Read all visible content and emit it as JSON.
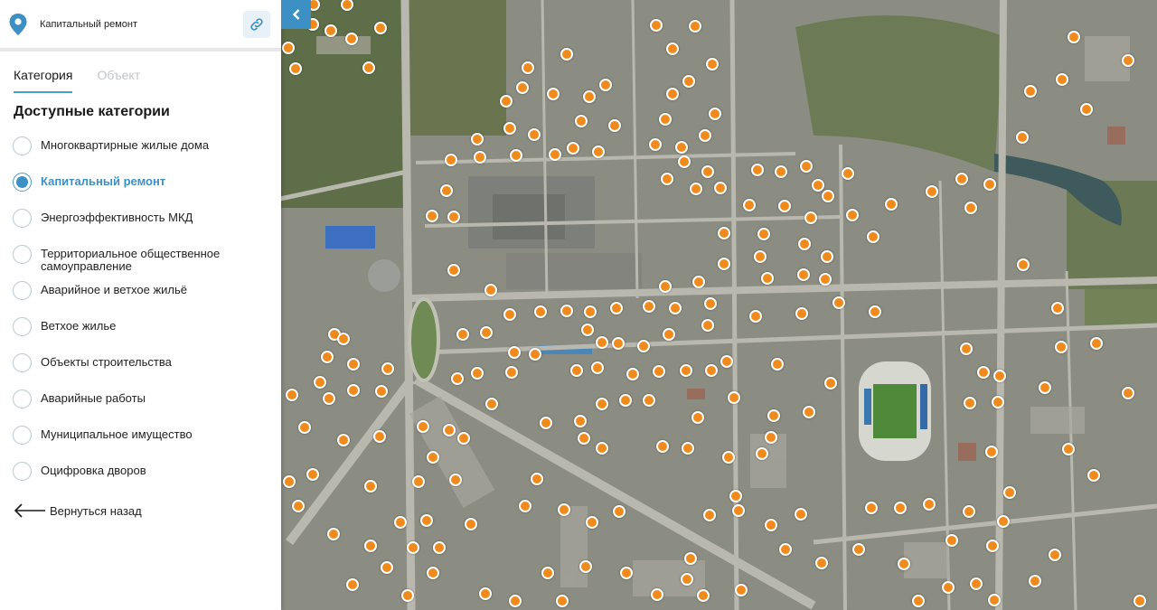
{
  "header": {
    "title": "Капитальный ремонт",
    "pin_icon": "location-pin-icon",
    "link_icon": "link-icon"
  },
  "tabs": [
    {
      "label": "Категория",
      "active": true
    },
    {
      "label": "Объект",
      "active": false
    }
  ],
  "section_title": "Доступные категории",
  "categories": [
    {
      "label": "Многоквартирные жилые дома",
      "checked": false
    },
    {
      "label": "Капитальный ремонт",
      "checked": true
    },
    {
      "label": "Энергоэффективность МКД",
      "checked": false
    },
    {
      "label": "Территориальное общественное самоуправление",
      "checked": false
    },
    {
      "label": "Аварийное и ветхое жильё",
      "checked": false
    },
    {
      "label": "Ветхое жилье",
      "checked": false
    },
    {
      "label": "Объекты строительства",
      "checked": false
    },
    {
      "label": "Аварийные работы",
      "checked": false
    },
    {
      "label": "Муниципальное имущество",
      "checked": false
    },
    {
      "label": "Оцифровка дворов",
      "checked": false
    }
  ],
  "back": {
    "label": "Вернуться назад",
    "icon": "arrow-left-icon"
  },
  "collapse": {
    "icon": "chevron-left-icon"
  },
  "colors": {
    "accent": "#3c90c4",
    "marker": "#f08a1c",
    "tab_underline": "#4a9ec9"
  },
  "map": {
    "layer": "satellite",
    "marker_count_visible": 230
  }
}
